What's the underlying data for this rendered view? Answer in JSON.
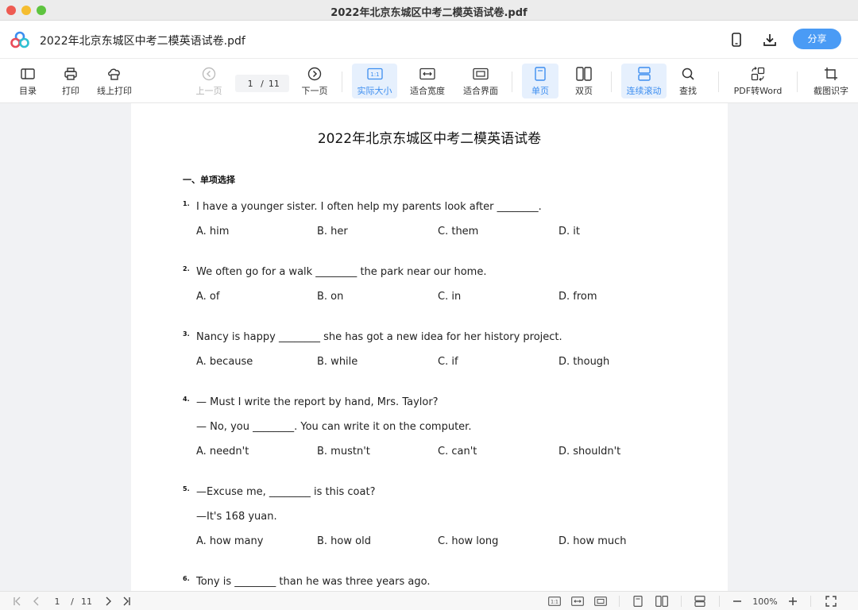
{
  "window": {
    "title": "2022年北京东城区中考二模英语试卷.pdf"
  },
  "header": {
    "doc_name": "2022年北京东城区中考二模英语试卷.pdf",
    "share_label": "分享"
  },
  "toolbar": {
    "toc": "目录",
    "print": "打印",
    "online_print": "线上打印",
    "prev": "上一页",
    "page_current": "1",
    "page_sep": "/",
    "page_total": "11",
    "next": "下一页",
    "actual_size": "实际大小",
    "actual_size_icon_text": "1:1",
    "fit_width": "适合宽度",
    "fit_page": "适合界面",
    "single": "单页",
    "double": "双页",
    "continuous": "连续滚动",
    "find": "查找",
    "pdf_to_word": "PDF转Word",
    "ocr": "截图识字"
  },
  "document": {
    "title": "2022年北京东城区中考二模英语试卷",
    "section": "一、单项选择",
    "questions": [
      {
        "num": "1.",
        "lines": [
          "I have a younger sister. I often help my parents look after ________."
        ],
        "options": [
          "A. him",
          "B. her",
          "C. them",
          "D. it"
        ]
      },
      {
        "num": "2.",
        "lines": [
          "We often go for a walk ________ the park near our home."
        ],
        "options": [
          "A. of",
          "B. on",
          "C. in",
          "D. from"
        ]
      },
      {
        "num": "3.",
        "lines": [
          "Nancy is happy ________ she has got a new idea for her history project."
        ],
        "options": [
          "A. because",
          "B. while",
          "C. if",
          "D. though"
        ]
      },
      {
        "num": "4.",
        "lines": [
          "— Must I write the report by hand, Mrs. Taylor?",
          "— No, you ________. You can write it on the computer."
        ],
        "options": [
          "A. needn't",
          "B. mustn't",
          "C. can't",
          "D. shouldn't"
        ]
      },
      {
        "num": "5.",
        "lines": [
          "—Excuse me, ________ is this coat?",
          "—It's 168 yuan."
        ],
        "options": [
          "A. how many",
          "B. how old",
          "C. how long",
          "D. how much"
        ]
      },
      {
        "num": "6.",
        "lines": [
          "Tony is ________ than he was three years ago."
        ],
        "options": []
      }
    ]
  },
  "bottombar": {
    "page_current": "1",
    "page_sep": "/",
    "page_total": "11",
    "zoom": "100%",
    "fit_icon_text": "1:1"
  },
  "colors": {
    "accent": "#4a9bf5",
    "active_bg": "#e6f0fd",
    "active_text": "#3d8ef0"
  }
}
